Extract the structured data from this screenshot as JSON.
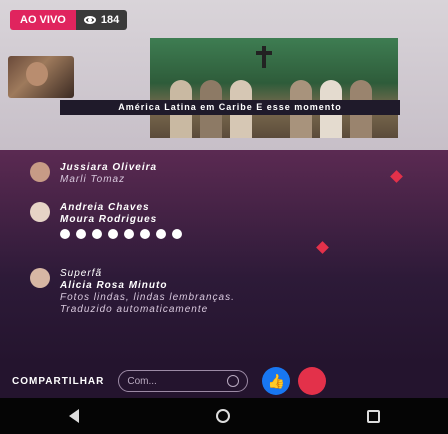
{
  "live": {
    "label": "AO VIVO",
    "viewers": "184"
  },
  "video": {
    "caption": "América Latina em Caribe E esse momento"
  },
  "comments": [
    {
      "name": "Jussiara Oliveira",
      "text": "Marli Tomaz"
    },
    {
      "name": "Andreia Chaves",
      "text": "Moura Rodrigues"
    },
    {
      "name": "Alicia Rosa Minuto",
      "badge": "Superfã",
      "text": "Fotos lindas, lindas lembranças.",
      "translated": "Traduzido automaticamente"
    }
  ],
  "bottom": {
    "share": "COMPARTILHAR",
    "comment_placeholder": "Com..."
  },
  "icons": [
    "eye-icon",
    "smile-icon",
    "like-icon",
    "love-icon",
    "back-icon",
    "home-icon",
    "recent-apps-icon"
  ],
  "colors": {
    "live": "#e0245e",
    "like": "#1877f2",
    "love": "#e3314a"
  }
}
